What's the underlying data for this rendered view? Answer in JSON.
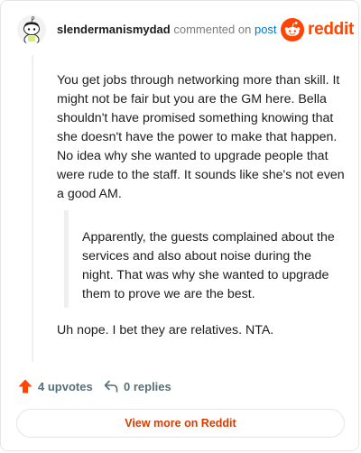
{
  "header": {
    "username": "slendermanismydad",
    "commented_text": "commented on",
    "post_link": "post",
    "brand": "reddit"
  },
  "comment": {
    "paragraph": "You get jobs through networking more than skill. It might not be fair but you are the GM here. Bella shouldn't have promised something knowing that she doesn't have the power to make that happen. No idea why she wanted to upgrade people that were rude to the staff. It sounds like she's not even a good AM.",
    "quote": "Apparently, the guests complained about the services and also about noise during the night. That was why she wanted to upgrade them to prove we are the best.",
    "tail": "Uh nope. I bet they are relatives. NTA."
  },
  "actions": {
    "upvotes": "4 upvotes",
    "replies": "0 replies"
  },
  "footer": {
    "view_more": "View more on Reddit"
  },
  "colors": {
    "brand": "#ff4500",
    "link": "#0079d3",
    "button_text": "#d93a00"
  },
  "icons": {
    "avatar": "snoo-avatar",
    "brand_logo": "reddit-logo-icon",
    "upvote": "upvote-arrow-icon",
    "reply": "reply-arrow-icon"
  }
}
